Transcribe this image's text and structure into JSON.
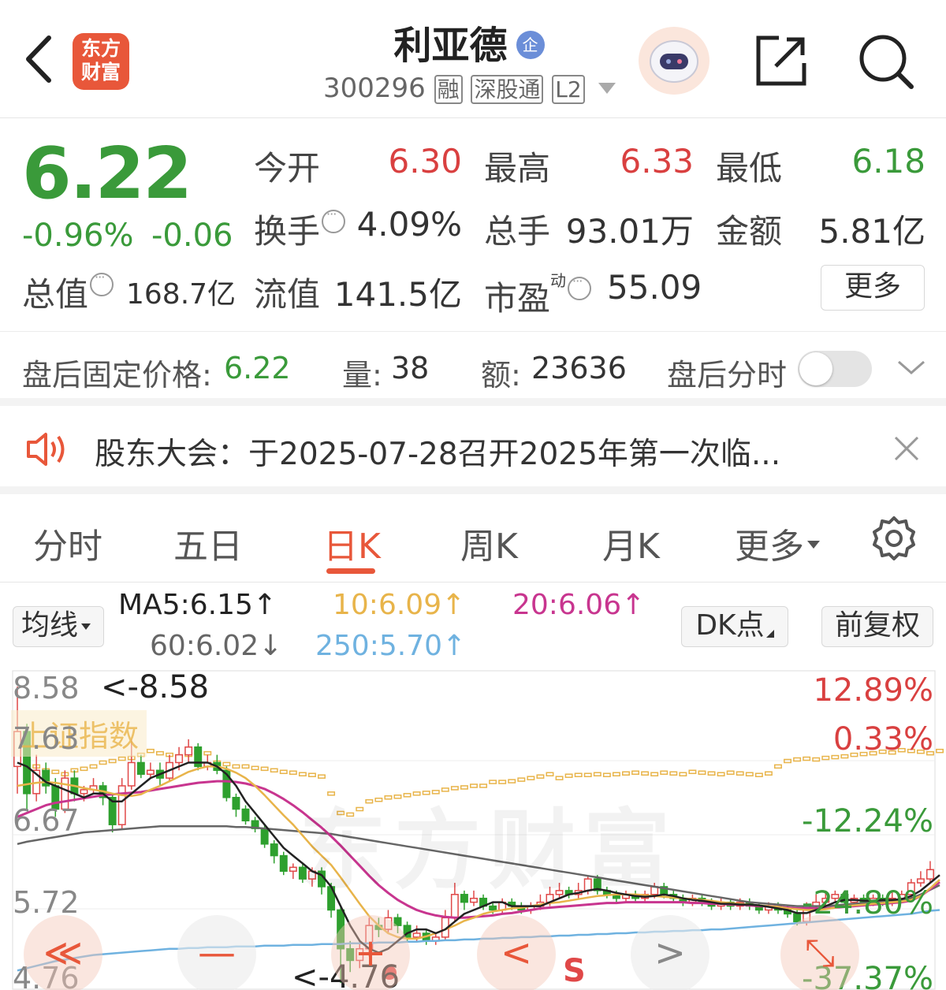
{
  "header": {
    "back": "‹",
    "logo_line1": "东方",
    "logo_line2": "财富",
    "stock_name": "利亚德",
    "badge": "企",
    "code": "300296",
    "tags": [
      "融",
      "深股通",
      "L2"
    ]
  },
  "quote": {
    "price": "6.22",
    "change_pct": "-0.96%",
    "change": "-0.06",
    "open_label": "今开",
    "open": "6.30",
    "high_label": "最高",
    "high": "6.33",
    "low_label": "最低",
    "low": "6.18",
    "turnover_label": "换手",
    "turnover": "4.09%",
    "volume_label": "总手",
    "volume": "93.01万",
    "amount_label": "金额",
    "amount": "5.81亿",
    "mcap_label": "总值",
    "mcap": "168.7亿",
    "float_label": "流值",
    "float": "141.5亿",
    "pe_label": "市盈",
    "pe_sup": "动",
    "pe": "55.09",
    "more_button": "更多"
  },
  "after_hours": {
    "price_label": "盘后固定价格:",
    "price": "6.22",
    "volume_label": "量:",
    "volume": "38",
    "amount_label": "额:",
    "amount": "23636",
    "toggle_label": "盘后分时",
    "toggle_on": false
  },
  "notice": {
    "text": "股东大会：于2025-07-28召开2025年第一次临..."
  },
  "tabs": [
    {
      "label": "分时"
    },
    {
      "label": "五日"
    },
    {
      "label": "日K",
      "active": true
    },
    {
      "label": "周K"
    },
    {
      "label": "月K"
    },
    {
      "label": "更多"
    }
  ],
  "ma_bar": {
    "selector": "均线",
    "ma5": "MA5:6.15↑",
    "ma10": "10:6.09↑",
    "ma20": "20:6.06↑",
    "ma60": "60:6.02↓",
    "ma250": "250:5.70↑",
    "dk_button": "DK点",
    "adjust_button": "前复权"
  },
  "chart": {
    "y_labels": [
      "8.58",
      "7.63",
      "6.67",
      "5.72",
      "4.76"
    ],
    "pct_labels": [
      "12.89%",
      "0.33%",
      "-12.24%",
      "-24.80%",
      "-37.37%"
    ],
    "max_note": "<-8.58",
    "min_note": "<-4.76",
    "index_overlay": "上证指数",
    "watermark": "东方财富",
    "signal": "S",
    "colors": {
      "up": "#e04848",
      "down": "#2ea02e",
      "ma5": "#222222",
      "ma10": "#e8b44a",
      "ma20": "#c8358f",
      "ma60": "#666666",
      "ma250": "#6fb2e0",
      "index": "#e8b44a"
    }
  },
  "chart_data": {
    "type": "candlestick",
    "ylim": [
      4.76,
      8.58
    ],
    "candles": [
      [
        7.55,
        8.0,
        8.58,
        7.2
      ],
      [
        8.0,
        7.2,
        8.1,
        7.0
      ],
      [
        7.2,
        7.5,
        7.7,
        7.1
      ],
      [
        7.5,
        7.3,
        7.6,
        7.2
      ],
      [
        7.3,
        7.0,
        7.4,
        6.9
      ],
      [
        7.0,
        7.4,
        7.5,
        6.95
      ],
      [
        7.4,
        7.2,
        7.5,
        7.1
      ],
      [
        7.2,
        7.25,
        7.3,
        7.1
      ],
      [
        7.25,
        7.3,
        7.4,
        7.2
      ],
      [
        7.3,
        7.15,
        7.35,
        7.05
      ],
      [
        7.15,
        6.8,
        7.2,
        6.7
      ],
      [
        6.8,
        7.3,
        7.4,
        6.75
      ],
      [
        7.3,
        7.6,
        7.9,
        7.25
      ],
      [
        7.6,
        7.45,
        7.7,
        7.4
      ],
      [
        7.45,
        7.5,
        7.6,
        7.4
      ],
      [
        7.5,
        7.4,
        7.6,
        7.3
      ],
      [
        7.4,
        7.6,
        7.7,
        7.35
      ],
      [
        7.6,
        7.7,
        7.8,
        7.5
      ],
      [
        7.7,
        7.8,
        7.9,
        7.6
      ],
      [
        7.8,
        7.55,
        7.85,
        7.5
      ],
      [
        7.55,
        7.6,
        7.7,
        7.5
      ],
      [
        7.6,
        7.5,
        7.7,
        7.45
      ],
      [
        7.5,
        7.15,
        7.55,
        7.1
      ],
      [
        7.15,
        7.0,
        7.2,
        6.9
      ],
      [
        7.0,
        6.85,
        7.05,
        6.8
      ],
      [
        6.85,
        6.75,
        6.9,
        6.7
      ],
      [
        6.75,
        6.55,
        6.8,
        6.5
      ],
      [
        6.55,
        6.4,
        6.6,
        6.3
      ],
      [
        6.4,
        6.2,
        6.45,
        6.15
      ],
      [
        6.2,
        6.25,
        6.3,
        6.1
      ],
      [
        6.25,
        6.1,
        6.3,
        6.05
      ],
      [
        6.1,
        6.2,
        6.25,
        6.0
      ],
      [
        6.2,
        6.0,
        6.25,
        5.9
      ],
      [
        6.0,
        5.7,
        6.05,
        5.6
      ],
      [
        5.7,
        5.2,
        5.75,
        4.76
      ],
      [
        5.2,
        5.05,
        5.3,
        4.9
      ],
      [
        5.05,
        5.2,
        5.3,
        4.95
      ],
      [
        5.2,
        5.5,
        5.6,
        5.1
      ],
      [
        5.5,
        5.45,
        5.6,
        5.35
      ],
      [
        5.45,
        5.6,
        5.7,
        5.4
      ],
      [
        5.6,
        5.5,
        5.65,
        5.4
      ],
      [
        5.5,
        5.35,
        5.55,
        5.3
      ],
      [
        5.35,
        5.4,
        5.5,
        5.3
      ],
      [
        5.4,
        5.3,
        5.45,
        5.25
      ],
      [
        5.3,
        5.35,
        5.4,
        5.25
      ],
      [
        5.35,
        5.6,
        5.7,
        5.3
      ],
      [
        5.6,
        5.9,
        6.05,
        5.55
      ],
      [
        5.9,
        5.8,
        5.95,
        5.7
      ],
      [
        5.8,
        5.85,
        5.95,
        5.75
      ],
      [
        5.85,
        5.75,
        5.9,
        5.7
      ],
      [
        5.75,
        5.7,
        5.8,
        5.65
      ],
      [
        5.7,
        5.8,
        5.85,
        5.65
      ],
      [
        5.8,
        5.75,
        5.85,
        5.7
      ],
      [
        5.75,
        5.7,
        5.8,
        5.65
      ],
      [
        5.7,
        5.75,
        5.8,
        5.65
      ],
      [
        5.75,
        5.8,
        5.9,
        5.7
      ],
      [
        5.8,
        5.9,
        6.0,
        5.75
      ],
      [
        5.9,
        5.95,
        6.05,
        5.85
      ],
      [
        5.95,
        5.9,
        6.0,
        5.85
      ],
      [
        5.9,
        5.95,
        6.05,
        5.85
      ],
      [
        5.95,
        6.1,
        6.15,
        5.9
      ],
      [
        6.1,
        5.95,
        6.15,
        5.9
      ],
      [
        5.95,
        5.9,
        6.0,
        5.85
      ],
      [
        5.9,
        5.85,
        5.95,
        5.8
      ],
      [
        5.85,
        5.9,
        5.95,
        5.8
      ],
      [
        5.9,
        5.85,
        5.95,
        5.8
      ],
      [
        5.85,
        5.9,
        5.95,
        5.8
      ],
      [
        5.9,
        6.0,
        6.05,
        5.85
      ],
      [
        6.0,
        5.9,
        6.05,
        5.85
      ],
      [
        5.9,
        5.85,
        5.95,
        5.8
      ],
      [
        5.85,
        5.8,
        5.9,
        5.75
      ],
      [
        5.8,
        5.85,
        5.9,
        5.75
      ],
      [
        5.85,
        5.8,
        5.9,
        5.75
      ],
      [
        5.8,
        5.75,
        5.85,
        5.7
      ],
      [
        5.75,
        5.8,
        5.85,
        5.7
      ],
      [
        5.8,
        5.75,
        5.85,
        5.7
      ],
      [
        5.75,
        5.8,
        5.85,
        5.7
      ],
      [
        5.8,
        5.75,
        5.85,
        5.7
      ],
      [
        5.75,
        5.7,
        5.8,
        5.65
      ],
      [
        5.7,
        5.75,
        5.8,
        5.65
      ],
      [
        5.75,
        5.7,
        5.8,
        5.65
      ],
      [
        5.7,
        5.65,
        5.75,
        5.6
      ],
      [
        5.65,
        5.55,
        5.7,
        5.5
      ],
      [
        5.55,
        5.75,
        5.8,
        5.5
      ],
      [
        5.75,
        5.8,
        5.9,
        5.7
      ],
      [
        5.8,
        5.85,
        5.95,
        5.75
      ],
      [
        5.85,
        5.9,
        5.95,
        5.8
      ],
      [
        5.9,
        5.8,
        5.95,
        5.75
      ],
      [
        5.8,
        5.85,
        5.9,
        5.75
      ],
      [
        5.85,
        5.8,
        5.9,
        5.75
      ],
      [
        5.8,
        5.85,
        5.9,
        5.75
      ],
      [
        5.85,
        5.8,
        5.9,
        5.75
      ],
      [
        5.8,
        5.85,
        5.95,
        5.75
      ],
      [
        5.85,
        5.9,
        5.95,
        5.8
      ],
      [
        5.9,
        6.05,
        6.1,
        5.85
      ],
      [
        6.05,
        6.1,
        6.2,
        6.0
      ],
      [
        6.1,
        6.22,
        6.33,
        6.05
      ]
    ],
    "ma5": [
      7.6,
      7.55,
      7.45,
      7.35,
      7.3,
      7.25,
      7.2,
      7.15,
      7.2,
      7.2,
      7.1,
      7.1,
      7.2,
      7.3,
      7.4,
      7.45,
      7.5,
      7.55,
      7.6,
      7.6,
      7.6,
      7.55,
      7.45,
      7.3,
      7.1,
      6.95,
      6.8,
      6.65,
      6.5,
      6.4,
      6.3,
      6.2,
      6.15,
      6.0,
      5.75,
      5.5,
      5.3,
      5.2,
      5.15,
      5.2,
      5.3,
      5.4,
      5.45,
      5.45,
      5.4,
      5.45,
      5.55,
      5.65,
      5.7,
      5.75,
      5.8,
      5.8,
      5.75,
      5.75,
      5.75,
      5.75,
      5.8,
      5.85,
      5.9,
      5.92,
      5.95,
      5.97,
      5.95,
      5.92,
      5.9,
      5.88,
      5.87,
      5.88,
      5.9,
      5.88,
      5.85,
      5.83,
      5.82,
      5.8,
      5.78,
      5.78,
      5.77,
      5.77,
      5.76,
      5.74,
      5.72,
      5.7,
      5.66,
      5.66,
      5.7,
      5.75,
      5.8,
      5.83,
      5.83,
      5.82,
      5.82,
      5.83,
      5.83,
      5.84,
      5.88,
      5.95,
      6.05,
      6.15
    ],
    "ma10": [
      7.3,
      7.32,
      7.34,
      7.35,
      7.34,
      7.32,
      7.3,
      7.27,
      7.25,
      7.23,
      7.2,
      7.18,
      7.17,
      7.19,
      7.25,
      7.3,
      7.36,
      7.42,
      7.48,
      7.52,
      7.55,
      7.55,
      7.52,
      7.47,
      7.4,
      7.3,
      7.18,
      7.05,
      6.92,
      6.8,
      6.66,
      6.52,
      6.4,
      6.28,
      6.12,
      5.95,
      5.78,
      5.62,
      5.5,
      5.4,
      5.35,
      5.33,
      5.33,
      5.36,
      5.4,
      5.45,
      5.5,
      5.56,
      5.6,
      5.65,
      5.68,
      5.7,
      5.72,
      5.73,
      5.75,
      5.77,
      5.79,
      5.8,
      5.82,
      5.84,
      5.86,
      5.88,
      5.89,
      5.9,
      5.9,
      5.9,
      5.89,
      5.88,
      5.87,
      5.86,
      5.85,
      5.84,
      5.83,
      5.82,
      5.8,
      5.79,
      5.78,
      5.77,
      5.76,
      5.75,
      5.74,
      5.72,
      5.71,
      5.7,
      5.7,
      5.71,
      5.73,
      5.75,
      5.76,
      5.77,
      5.78,
      5.79,
      5.8,
      5.81,
      5.83,
      5.88,
      5.98,
      6.09
    ],
    "ma20": [
      6.9,
      6.95,
      7.0,
      7.05,
      7.08,
      7.1,
      7.12,
      7.14,
      7.16,
      7.18,
      7.19,
      7.2,
      7.21,
      7.22,
      7.24,
      7.26,
      7.28,
      7.3,
      7.32,
      7.34,
      7.35,
      7.36,
      7.36,
      7.35,
      7.33,
      7.3,
      7.26,
      7.2,
      7.13,
      7.05,
      6.96,
      6.86,
      6.76,
      6.65,
      6.53,
      6.4,
      6.27,
      6.14,
      6.02,
      5.92,
      5.83,
      5.76,
      5.7,
      5.66,
      5.63,
      5.61,
      5.6,
      5.6,
      5.61,
      5.62,
      5.63,
      5.65,
      5.66,
      5.68,
      5.7,
      5.72,
      5.73,
      5.74,
      5.75,
      5.76,
      5.77,
      5.78,
      5.79,
      5.79,
      5.8,
      5.8,
      5.8,
      5.8,
      5.8,
      5.8,
      5.8,
      5.79,
      5.79,
      5.78,
      5.78,
      5.77,
      5.77,
      5.76,
      5.75,
      5.75,
      5.74,
      5.73,
      5.72,
      5.72,
      5.72,
      5.72,
      5.73,
      5.74,
      5.75,
      5.76,
      5.77,
      5.78,
      5.79,
      5.8,
      5.82,
      5.88,
      5.97,
      6.06
    ],
    "ma60": [
      6.55,
      6.58,
      6.6,
      6.62,
      6.64,
      6.66,
      6.68,
      6.7,
      6.71,
      6.72,
      6.73,
      6.74,
      6.75,
      6.76,
      6.77,
      6.78,
      6.78,
      6.78,
      6.78,
      6.78,
      6.78,
      6.78,
      6.78,
      6.77,
      6.77,
      6.76,
      6.75,
      6.74,
      6.73,
      6.72,
      6.71,
      6.7,
      6.69,
      6.68,
      6.66,
      6.64,
      6.62,
      6.6,
      6.58,
      6.56,
      6.54,
      6.52,
      6.5,
      6.48,
      6.46,
      6.44,
      6.42,
      6.4,
      6.38,
      6.36,
      6.34,
      6.32,
      6.3,
      6.28,
      6.26,
      6.24,
      6.22,
      6.2,
      6.18,
      6.16,
      6.14,
      6.12,
      6.1,
      6.08,
      6.06,
      6.04,
      6.02,
      6.0,
      5.98,
      5.96,
      5.94,
      5.92,
      5.9,
      5.88,
      5.86,
      5.84,
      5.82,
      5.8,
      5.79,
      5.78,
      5.77,
      5.76,
      5.75,
      5.75,
      5.75,
      5.75,
      5.76,
      5.77,
      5.78,
      5.79,
      5.8,
      5.81,
      5.82,
      5.83,
      5.85,
      5.9,
      5.96,
      6.02
    ],
    "ma250": [
      4.92,
      4.95,
      4.98,
      5.01,
      5.04,
      5.06,
      5.08,
      5.1,
      5.12,
      5.13,
      5.14,
      5.15,
      5.16,
      5.17,
      5.18,
      5.19,
      5.2,
      5.2,
      5.21,
      5.21,
      5.22,
      5.22,
      5.22,
      5.23,
      5.23,
      5.23,
      5.24,
      5.24,
      5.24,
      5.25,
      5.25,
      5.25,
      5.26,
      5.26,
      5.26,
      5.27,
      5.27,
      5.27,
      5.28,
      5.28,
      5.28,
      5.29,
      5.29,
      5.3,
      5.3,
      5.31,
      5.31,
      5.32,
      5.32,
      5.33,
      5.33,
      5.34,
      5.34,
      5.35,
      5.35,
      5.36,
      5.36,
      5.37,
      5.37,
      5.38,
      5.38,
      5.39,
      5.39,
      5.4,
      5.4,
      5.41,
      5.41,
      5.42,
      5.42,
      5.43,
      5.43,
      5.44,
      5.44,
      5.45,
      5.45,
      5.46,
      5.47,
      5.48,
      5.49,
      5.5,
      5.51,
      5.52,
      5.53,
      5.54,
      5.55,
      5.56,
      5.57,
      5.58,
      5.59,
      5.6,
      5.61,
      5.62,
      5.63,
      5.64,
      5.65,
      5.67,
      5.69,
      5.7
    ],
    "index": [
      7.6,
      7.58,
      7.55,
      7.5,
      7.48,
      7.45,
      7.5,
      7.52,
      7.55,
      7.6,
      7.62,
      7.65,
      7.66,
      7.7,
      7.75,
      7.72,
      7.7,
      7.68,
      7.7,
      7.73,
      7.72,
      7.6,
      7.58,
      7.55,
      7.55,
      7.53,
      7.52,
      7.5,
      7.48,
      7.47,
      7.45,
      7.44,
      7.42,
      7.2,
      6.95,
      6.93,
      7.0,
      7.1,
      7.12,
      7.15,
      7.16,
      7.18,
      7.2,
      7.21,
      7.22,
      7.25,
      7.27,
      7.28,
      7.3,
      7.3,
      7.35,
      7.35,
      7.36,
      7.38,
      7.4,
      7.42,
      7.45,
      7.4,
      7.43,
      7.44,
      7.44,
      7.45,
      7.44,
      7.45,
      7.46,
      7.47,
      7.46,
      7.45,
      7.47,
      7.46,
      7.45,
      7.48,
      7.47,
      7.46,
      7.45,
      7.47,
      7.46,
      7.45,
      7.44,
      7.46,
      7.55,
      7.62,
      7.64,
      7.65,
      7.64,
      7.66,
      7.67,
      7.68,
      7.7,
      7.71,
      7.72,
      7.74,
      7.73,
      7.76,
      7.75,
      7.74,
      7.72,
      7.75
    ]
  },
  "bottom_controls": [
    "≪",
    "—",
    "+",
    "<",
    ">",
    "⤡"
  ]
}
